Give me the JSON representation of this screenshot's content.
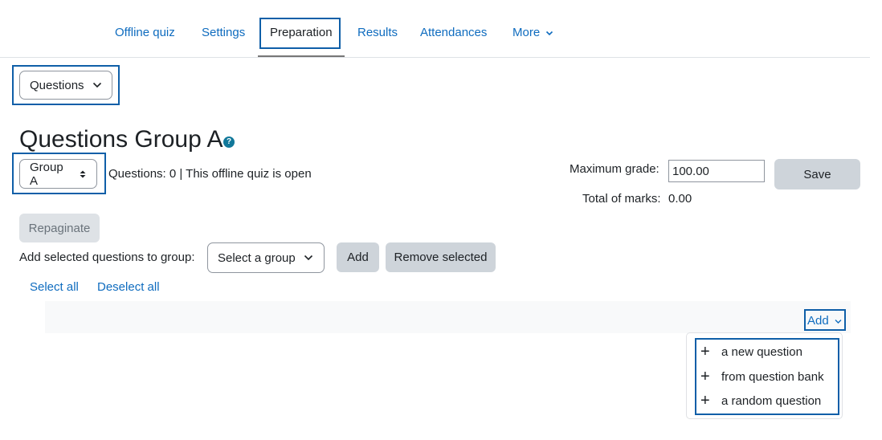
{
  "nav": {
    "tabs": [
      "Offline quiz",
      "Settings",
      "Preparation",
      "Results",
      "Attendances",
      "More"
    ],
    "active": "Preparation"
  },
  "section_select": {
    "value": "Questions"
  },
  "page_title": "Questions Group A",
  "group_select": {
    "value": "Group A"
  },
  "status_text": "Questions: 0 | This offline quiz is open",
  "grade": {
    "max_label": "Maximum grade:",
    "max_value": "100.00",
    "save_label": "Save",
    "total_label": "Total of marks:",
    "total_value": "0.00"
  },
  "repaginate_label": "Repaginate",
  "add_to_group": {
    "label": "Add selected questions to group:",
    "select_placeholder": "Select a group",
    "add_label": "Add",
    "remove_label": "Remove selected"
  },
  "select_all_label": "Select all",
  "deselect_all_label": "Deselect all",
  "add_menu": {
    "label": "Add",
    "items": [
      "a new question",
      "from question bank",
      "a random question"
    ]
  },
  "colors": {
    "link": "#0f6cbf",
    "highlight": "#0f5fa8",
    "button_gray": "#ced4da"
  }
}
